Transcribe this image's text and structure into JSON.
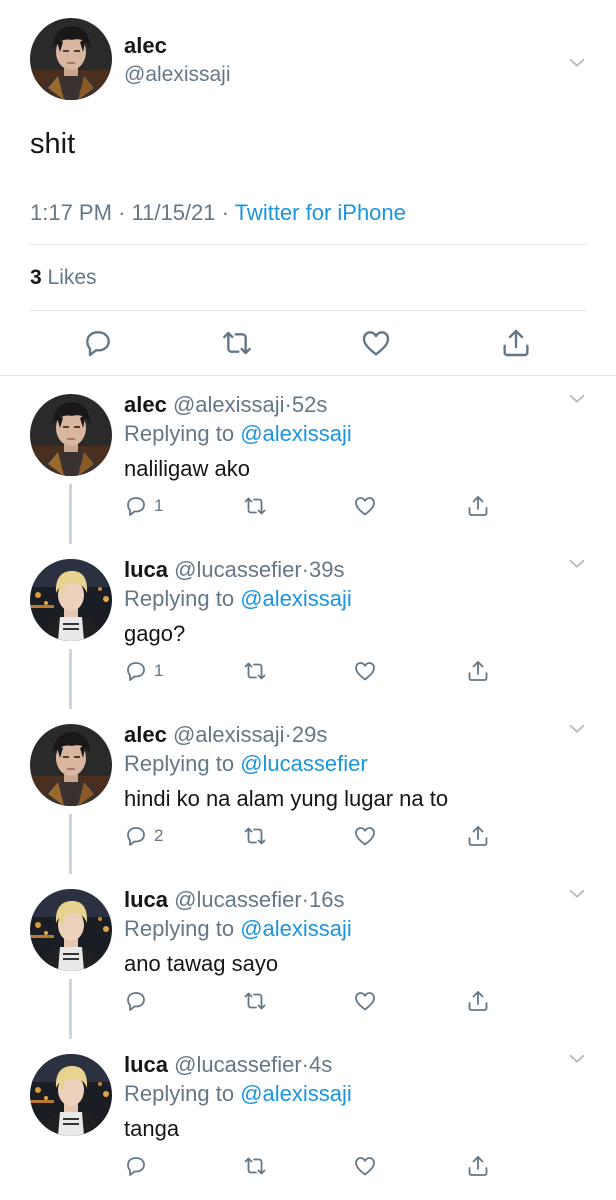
{
  "main_tweet": {
    "name": "alec",
    "handle": "@alexissaji",
    "text": "shit",
    "time": "1:17 PM",
    "date": "11/15/21",
    "sep1": "·",
    "sep2": "·",
    "source": "Twitter for iPhone",
    "likes_count": "3",
    "likes_label": "Likes",
    "icons": [
      "reply-icon",
      "retweet-icon",
      "like-icon",
      "share-icon"
    ]
  },
  "replies": [
    {
      "name": "alec",
      "handle": "@alexissaji",
      "dot": "·",
      "time": "52s",
      "replying_label": "Replying to",
      "replying_to": "@alexissaji",
      "text": "naliligaw ako",
      "reply_count": "1",
      "avatar": "alec"
    },
    {
      "name": "luca",
      "handle": "@lucassefier",
      "dot": "·",
      "time": "39s",
      "replying_label": "Replying to",
      "replying_to": "@alexissaji",
      "text": "gago?",
      "reply_count": "1",
      "avatar": "luca"
    },
    {
      "name": "alec",
      "handle": "@alexissaji",
      "dot": "·",
      "time": "29s",
      "replying_label": "Replying to",
      "replying_to": "@lucassefier",
      "text": "hindi ko na alam yung lugar na to",
      "reply_count": "2",
      "avatar": "alec"
    },
    {
      "name": "luca",
      "handle": "@lucassefier",
      "dot": "·",
      "time": "16s",
      "replying_label": "Replying to",
      "replying_to": "@alexissaji",
      "text": "ano tawag sayo",
      "reply_count": "",
      "avatar": "luca"
    },
    {
      "name": "luca",
      "handle": "@lucassefier",
      "dot": "·",
      "time": "4s",
      "replying_label": "Replying to",
      "replying_to": "@alexissaji",
      "text": "tanga",
      "reply_count": "",
      "avatar": "luca"
    }
  ],
  "colors": {
    "accent": "#1b95e0",
    "secondary_text": "#657786",
    "divider": "#e1e8ed",
    "thread_line": "#ccd6dd"
  }
}
